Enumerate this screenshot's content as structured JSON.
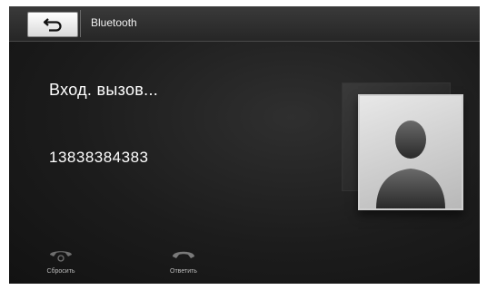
{
  "header": {
    "title": "Bluetooth",
    "back_icon": "return-arrow-icon"
  },
  "call": {
    "status": "Вход. вызов...",
    "number": "13838384383"
  },
  "contact": {
    "avatar_icon": "person-silhouette-icon"
  },
  "actions": {
    "reject_label": "Сбросить",
    "answer_label": "Ответить",
    "reject_icon": "phone-hangup-icon",
    "answer_icon": "phone-answer-icon"
  }
}
